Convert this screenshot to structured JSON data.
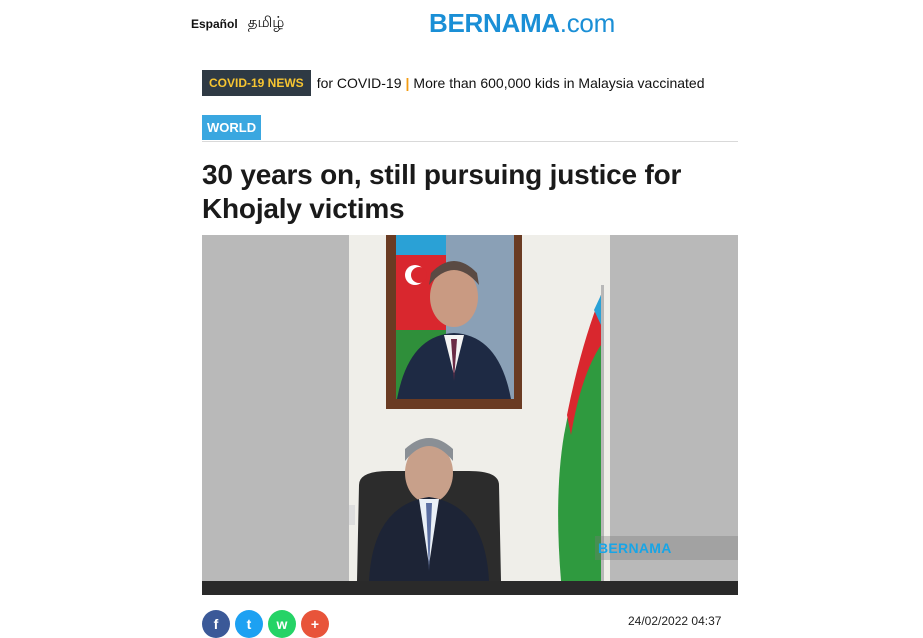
{
  "header": {
    "lang_es": "Español",
    "lang_ta": "தமிழ்",
    "brand_name": "BERNAMA",
    "brand_tld": ".com",
    "brand_color": "#1a8fd6"
  },
  "ticker": {
    "label": "COVID-19 NEWS",
    "item1": "for COVID-19",
    "item2": "More than 600,000 kids in Malaysia vaccinated",
    "separator": "|"
  },
  "article": {
    "category": "WORLD",
    "headline": "30 years on, still pursuing justice for Khojaly victims",
    "watermark": "BERNAMA",
    "date": "24/02/2022 04:37"
  },
  "share": {
    "facebook": "f",
    "twitter": "t",
    "whatsapp": "w",
    "more": "+"
  }
}
